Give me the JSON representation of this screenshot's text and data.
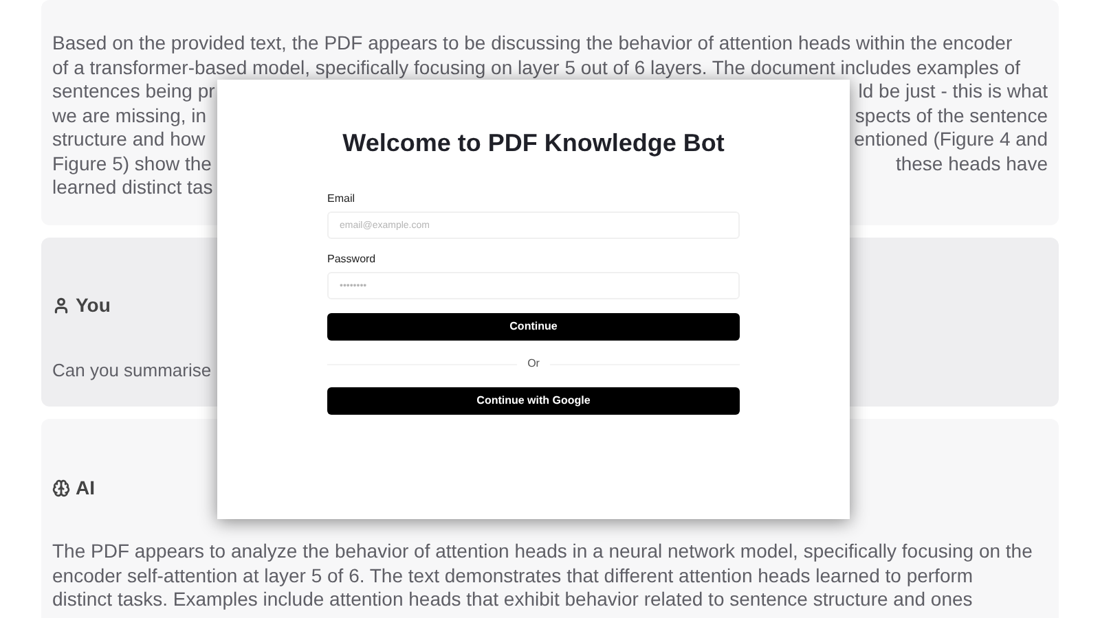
{
  "messages": [
    {
      "kind": "ai",
      "lines": [
        {
          "left": "Based on the provided text, the PDF appears to be discussing the behavior of attention heads within the encoder"
        },
        {
          "left": "of a transformer-based model, specifically focusing on layer 5 out of 6 layers. The document includes examples of"
        },
        {
          "left": "sentences being pr",
          "right": "ld be just - this is what"
        },
        {
          "left": "we are missing, in",
          "right": "spects of the sentence"
        },
        {
          "left": "structure and how",
          "right": "entioned (Figure 4 and"
        },
        {
          "left": "Figure 5) show the",
          "right": "these heads have"
        },
        {
          "left": "learned distinct tas"
        }
      ]
    },
    {
      "kind": "user",
      "heading": "You",
      "lines": [
        {
          "left": "Can you summarise"
        }
      ]
    },
    {
      "kind": "ai",
      "heading": "AI",
      "lines": [
        {
          "left": "The PDF appears to analyze the behavior of attention heads in a neural network model, specifically focusing on the"
        },
        {
          "left": "encoder self-attention at layer 5 of 6. The text demonstrates that different attention heads learned to perform"
        },
        {
          "left": "distinct tasks. Examples include attention heads that exhibit behavior related to sentence structure and ones"
        }
      ]
    }
  ],
  "dialog": {
    "title": "Welcome to PDF Knowledge Bot",
    "fields": [
      {
        "label": "Email",
        "placeholder": "email@example.com"
      },
      {
        "label": "Password",
        "placeholder": "••••••••"
      }
    ],
    "submit": "Continue",
    "divider": "Or",
    "google": "Continue with Google"
  }
}
